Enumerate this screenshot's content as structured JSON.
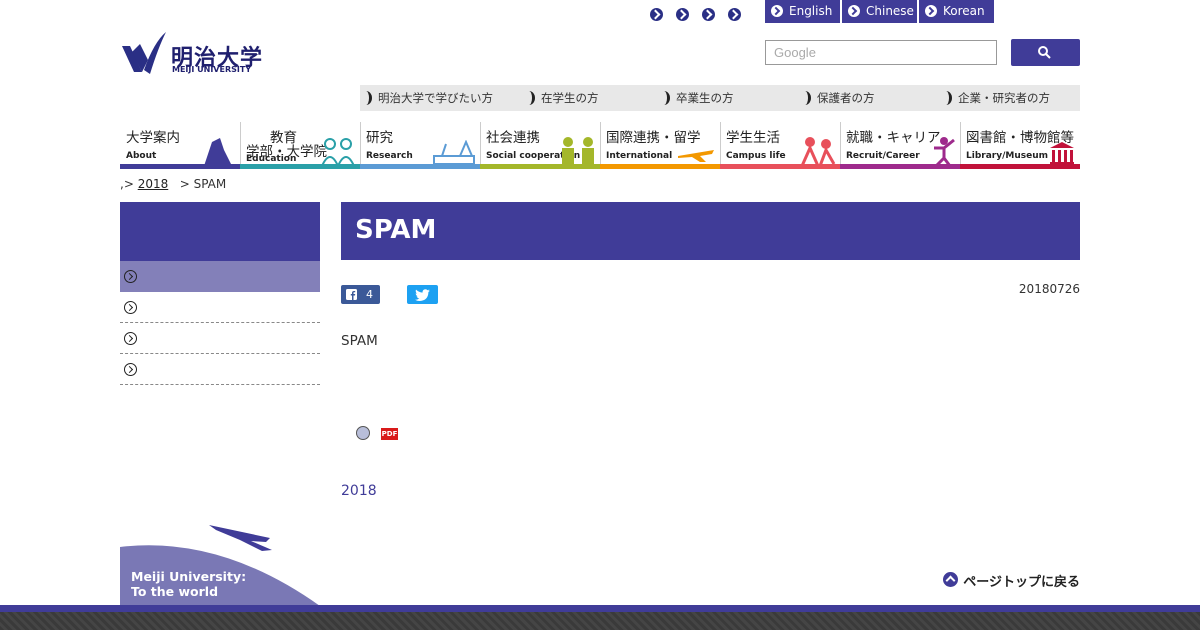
{
  "utility_icons": [
    "arrow-circle-icon",
    "arrow-circle-icon",
    "arrow-circle-icon",
    "arrow-circle-icon"
  ],
  "languages": [
    "English",
    "Chinese",
    "Korean"
  ],
  "logo": {
    "name": "明治大学",
    "sub": "MEIJI UNIVERSITY"
  },
  "search": {
    "placeholder": "Google"
  },
  "audience": [
    "明治大学で学びたい方",
    "在学生の方",
    "卒業生の方",
    "保護者の方",
    "企業・研究者の方"
  ],
  "nav": [
    {
      "jp": "大学案内",
      "en": "About",
      "color": "#403c98"
    },
    {
      "jp": "教育\n学部・大学院",
      "en": "Education",
      "color": "#2aa0a8"
    },
    {
      "jp": "研究",
      "en": "Research",
      "color": "#5b9bd5"
    },
    {
      "jp": "社会連携",
      "en": "Social cooperation",
      "color": "#a4b72a"
    },
    {
      "jp": "国際連携・留学",
      "en": "International",
      "color": "#f39800"
    },
    {
      "jp": "学生生活",
      "en": "Campus life",
      "color": "#e8505b"
    },
    {
      "jp": "就職・キャリア",
      "en": "Recruit/Career",
      "color": "#9e2a8c"
    },
    {
      "jp": "図書館・博物館等",
      "en": "Library/Museum",
      "color": "#c1123a"
    }
  ],
  "breadcrumb": {
    "prefix": ",>",
    "year": "2018",
    "sep": ">",
    "current": "SPAM"
  },
  "main": {
    "title": "SPAM",
    "fb_count": "4",
    "date": "20180726",
    "body": "SPAM",
    "pdf_label": "PDF",
    "year_link": "2018"
  },
  "footer": {
    "world_line1": "Meiji University:",
    "world_line2": "To the world",
    "pagetop": "ページトップに戻る"
  }
}
